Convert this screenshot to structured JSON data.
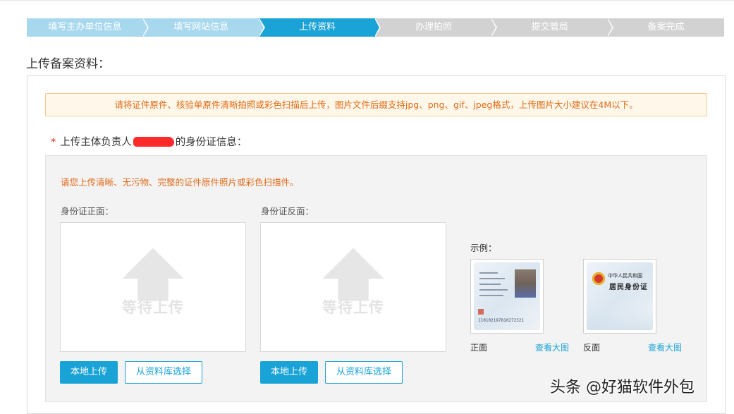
{
  "steps": [
    {
      "label": "填写主办单位信息",
      "state": "done"
    },
    {
      "label": "填写网站信息",
      "state": "done"
    },
    {
      "label": "上传资料",
      "state": "active"
    },
    {
      "label": "办理拍照",
      "state": "todo"
    },
    {
      "label": "提交管局",
      "state": "todo"
    },
    {
      "label": "备案完成",
      "state": "todo"
    }
  ],
  "section_title": "上传备案资料：",
  "notice": "请将证件原件、核验单原件清晰拍照或彩色扫描后上传，图片文件后缀支持jpg、png、gif、jpeg格式，上传图片大小建议在4M以下。",
  "required_label": {
    "star": "*",
    "prefix": "上传主体负责人",
    "suffix": "的身份证信息："
  },
  "upload_tip": "请您上传清晰、无污物、完整的证件原件照片或彩色扫描件。",
  "front": {
    "label": "身份证正面：",
    "placeholder": "等待上传",
    "local_button": "本地上传",
    "library_button": "从资料库选择"
  },
  "back": {
    "label": "身份证反面：",
    "placeholder": "等待上传",
    "local_button": "本地上传",
    "library_button": "从资料库选择"
  },
  "example": {
    "label": "示例：",
    "front_caption": "正面",
    "back_caption": "反面",
    "view_large": "查看大图",
    "front_card_number": "110102197810272321",
    "back_card_title_small": "中华人民共和国",
    "back_card_title_big": "居民身份证"
  },
  "watermark": "头条 @好猫软件外包",
  "colors": {
    "primary": "#1aa3d6",
    "step_done": "#a7d8ee",
    "step_todo": "#d2d2d2",
    "warning_text": "#e06a17",
    "required_star": "#e0281c"
  }
}
